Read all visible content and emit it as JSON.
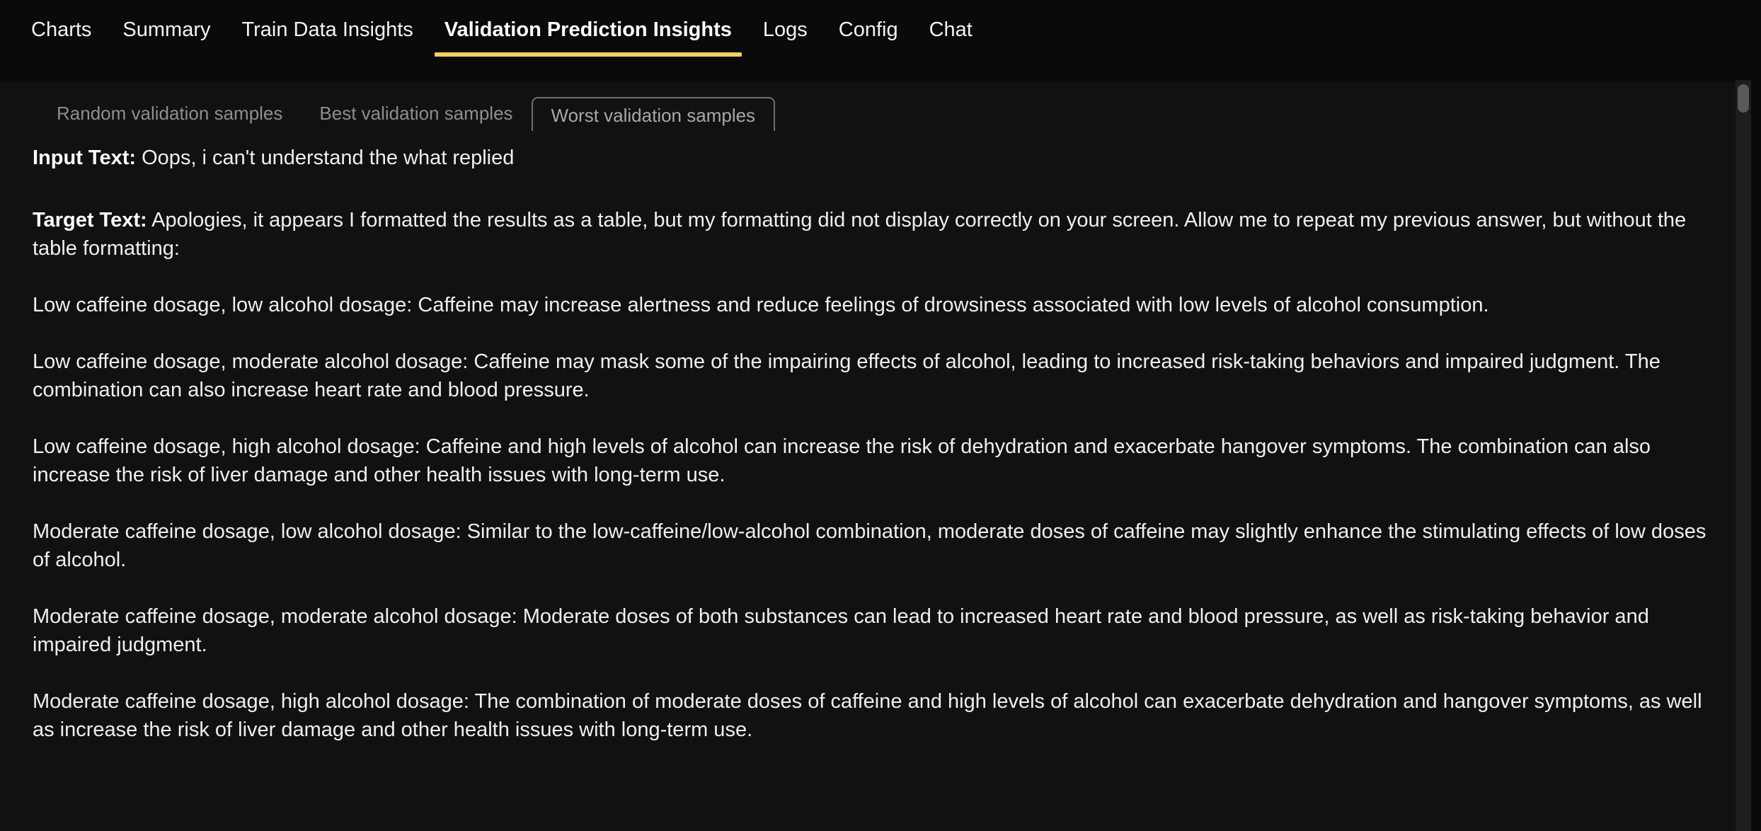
{
  "topnav": {
    "items": [
      {
        "label": "Charts",
        "active": false
      },
      {
        "label": "Summary",
        "active": false
      },
      {
        "label": "Train Data Insights",
        "active": false
      },
      {
        "label": "Validation Prediction Insights",
        "active": true
      },
      {
        "label": "Logs",
        "active": false
      },
      {
        "label": "Config",
        "active": false
      },
      {
        "label": "Chat",
        "active": false
      }
    ],
    "accent_color": "#f5cf61"
  },
  "subtabs": {
    "items": [
      {
        "label": "Random validation samples",
        "selected": false
      },
      {
        "label": "Best validation samples",
        "selected": false
      },
      {
        "label": "Worst validation samples",
        "selected": true
      }
    ]
  },
  "sample": {
    "input_label": "Input Text:",
    "input_text": "Oops, i can't understand the what replied",
    "target_label": "Target Text:",
    "target_intro": "Apologies, it appears I formatted the results as a table, but my formatting did not display correctly on your screen. Allow me to repeat my previous answer, but without the table formatting:",
    "target_paragraphs": [
      "Low caffeine dosage, low alcohol dosage: Caffeine may increase alertness and reduce feelings of drowsiness associated with low levels of alcohol consumption.",
      "Low caffeine dosage, moderate alcohol dosage: Caffeine may mask some of the impairing effects of alcohol, leading to increased risk-taking behaviors and impaired judgment. The combination can also increase heart rate and blood pressure.",
      "Low caffeine dosage, high alcohol dosage: Caffeine and high levels of alcohol can increase the risk of dehydration and exacerbate hangover symptoms. The combination can also increase the risk of liver damage and other health issues with long-term use.",
      "Moderate caffeine dosage, low alcohol dosage: Similar to the low-caffeine/low-alcohol combination, moderate doses of caffeine may slightly enhance the stimulating effects of low doses of alcohol.",
      "Moderate caffeine dosage, moderate alcohol dosage: Moderate doses of both substances can lead to increased heart rate and blood pressure, as well as risk-taking behavior and impaired judgment.",
      "Moderate caffeine dosage, high alcohol dosage: The combination of moderate doses of caffeine and high levels of alcohol can exacerbate dehydration and hangover symptoms, as well as increase the risk of liver damage and other health issues with long-term use."
    ]
  },
  "scrollbar": {
    "name": "vertical-scrollbar"
  }
}
